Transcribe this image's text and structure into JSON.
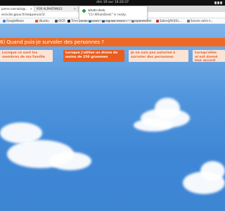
{
  "os": {
    "clock": "dim 19 avr  16:20:37"
  },
  "tabs": [
    {
      "label": "pierre.vannalai@...",
      "active": true
    },
    {
      "label": "POR ALPHATANGO",
      "active": false
    }
  ],
  "address": {
    "url": "ercicile.gouv.fr/sequence/1/"
  },
  "bookmarks": [
    {
      "label": "GoogleNews",
      "color": "#4285f4"
    },
    {
      "label": "Ubuntu",
      "color": "#e95420"
    },
    {
      "label": "OICR",
      "color": "#555555"
    },
    {
      "label": "Time Zones",
      "color": "#222222"
    },
    {
      "label": "OOM",
      "color": "#1a7ac9"
    },
    {
      "label": "Signalk Instru...",
      "color": "#2a5aa8"
    },
    {
      "label": "OpenPlotter",
      "color": "#888888"
    },
    {
      "label": "Sabre(JAV)(Ex...",
      "color": "#c0392b"
    },
    {
      "label": "Suivez votre e...",
      "color": "#7a7a7a"
    }
  ],
  "notification": {
    "title": "whats:desk",
    "body": "\"(1) WhatsDesk\" is ready"
  },
  "page": {
    "title": "6) Quand puis-je survoler des personnes ?",
    "options": [
      {
        "label": "Lorsque ce sont les membres de ma famille",
        "selected": false
      },
      {
        "label": "Lorsque j'utilise un drone de moins de 250 grammes",
        "selected": true
      },
      {
        "label": "Je ne suis pas autorisé à survoler des personnes",
        "selected": false
      },
      {
        "label": "Lorsqu'elles m'ont donné leur accord pour être survolées",
        "selected": false
      }
    ]
  },
  "colors": {
    "accent": "#ee6a24",
    "selected": "#e95e1f",
    "option_bg": "#fbe4d6",
    "sky": "#3f87d6"
  }
}
